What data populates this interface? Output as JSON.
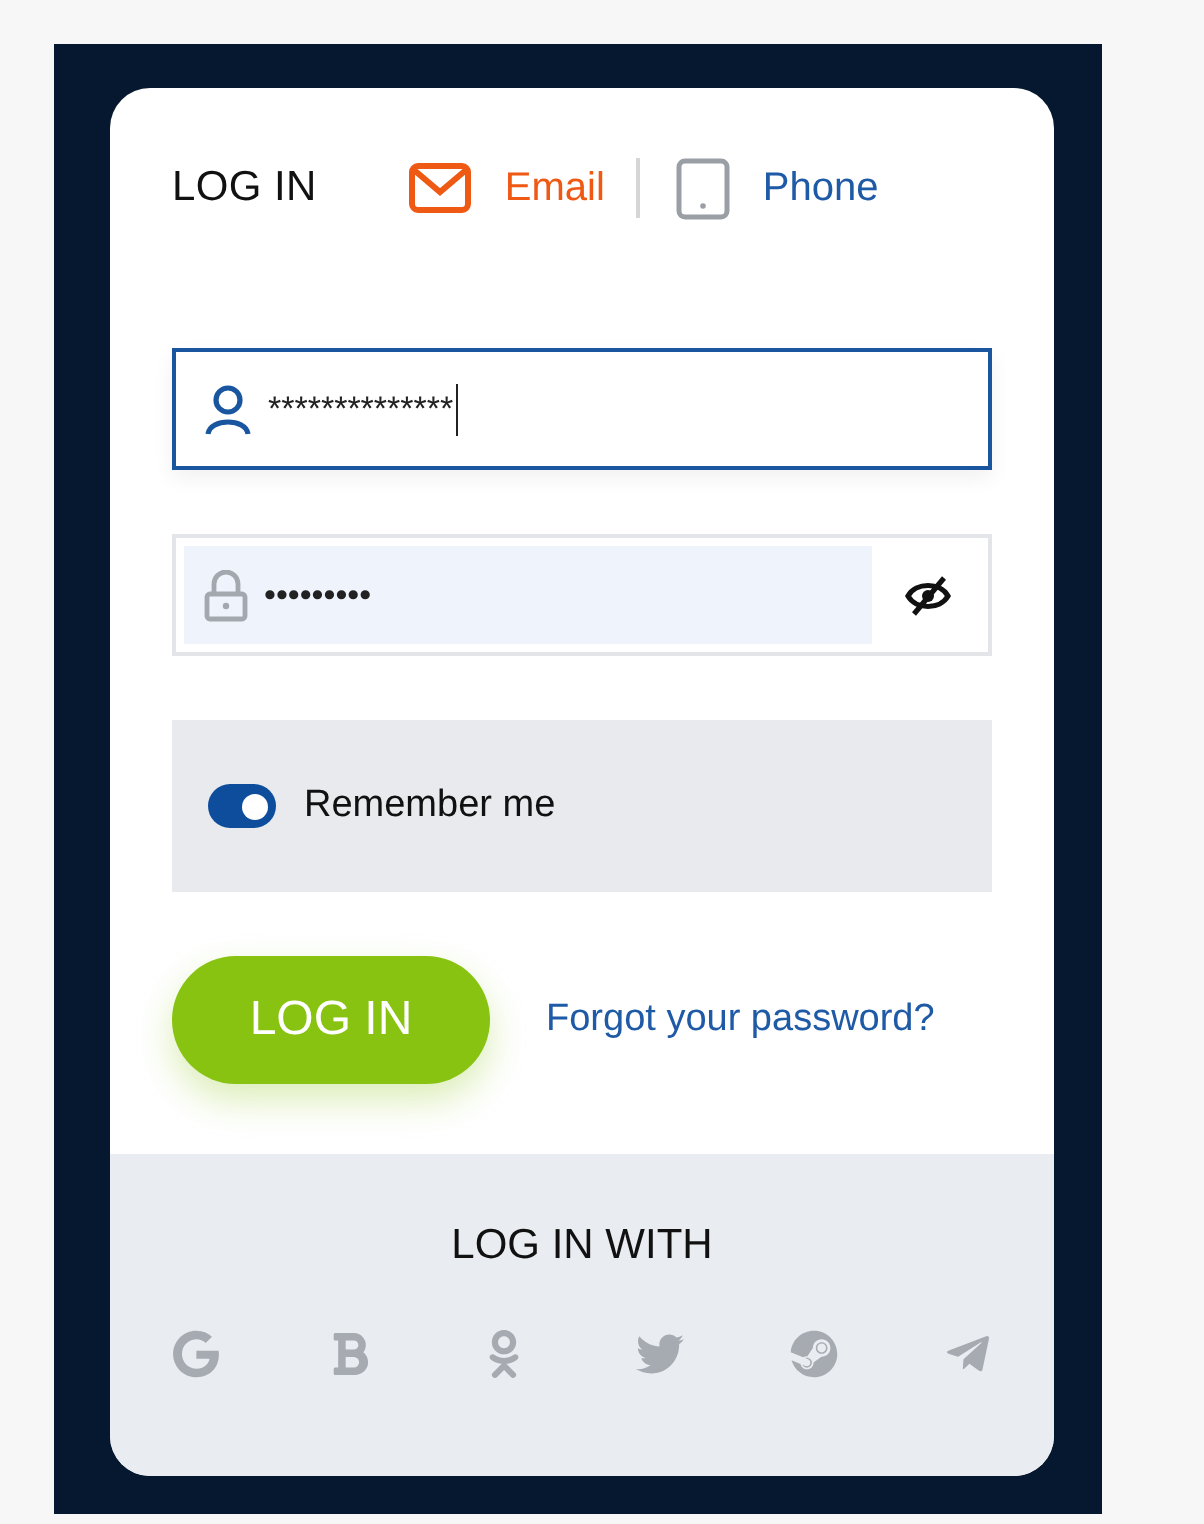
{
  "header": {
    "title": "LOG IN",
    "tabs": [
      {
        "kind": "email",
        "label": "Email",
        "selected": true
      },
      {
        "kind": "phone",
        "label": "Phone",
        "selected": false
      }
    ]
  },
  "login_field": {
    "value": "**************",
    "focused": true
  },
  "password_field": {
    "value": "•••••••••",
    "focused": false
  },
  "remember": {
    "label": "Remember me",
    "on": true
  },
  "login_button": "LOG IN",
  "forgot_link": "Forgot your password?",
  "social": {
    "title": "LOG IN WITH"
  }
}
